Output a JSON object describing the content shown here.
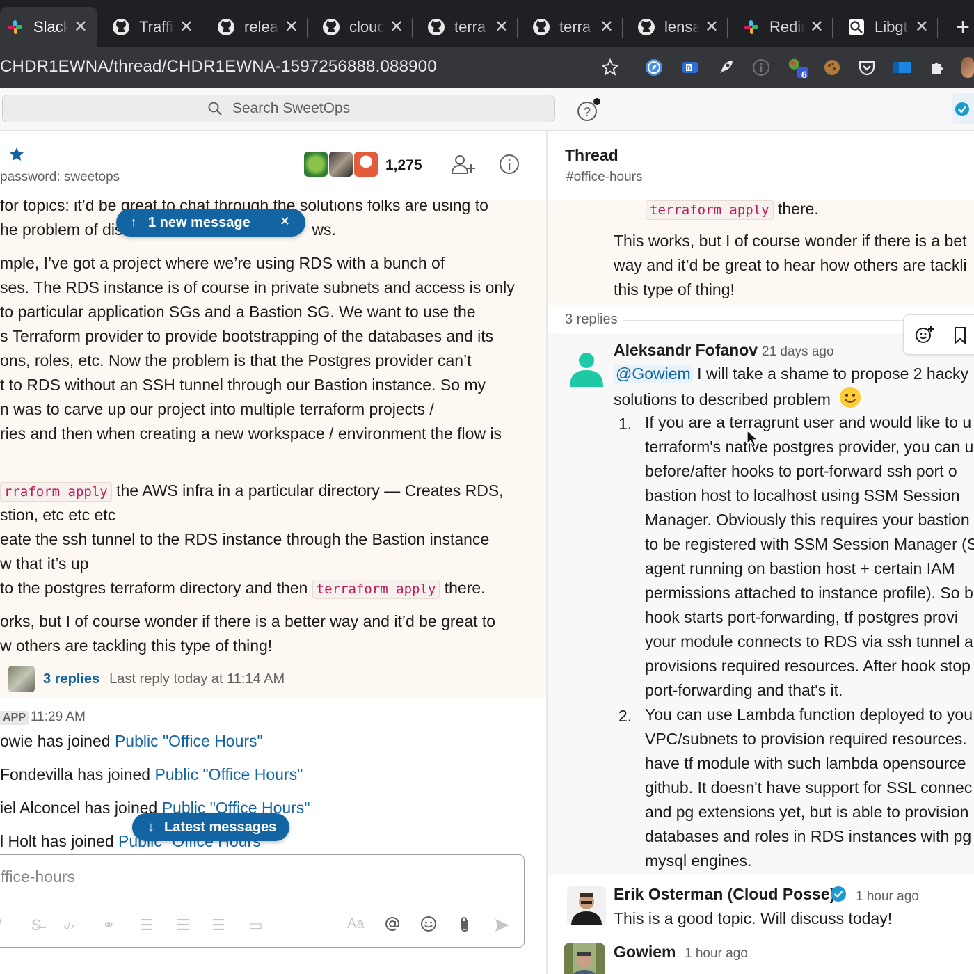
{
  "browser": {
    "tabs": [
      {
        "title": "Slack",
        "icon": "slack-icon",
        "active": true
      },
      {
        "title": "Traffi",
        "icon": "github-icon"
      },
      {
        "title": "relea",
        "icon": "github-icon"
      },
      {
        "title": "clouc",
        "icon": "github-icon"
      },
      {
        "title": "terra",
        "icon": "github-icon"
      },
      {
        "title": "terra",
        "icon": "github-icon"
      },
      {
        "title": "lensa",
        "icon": "github-icon"
      },
      {
        "title": "Redir",
        "icon": "slack-icon"
      },
      {
        "title": "Libgt",
        "icon": "search-icon"
      }
    ],
    "url": "CHDR1EWNA/thread/CHDR1EWNA-1597256888.088900",
    "extension_badge": "6"
  },
  "slack": {
    "search_placeholder": "Search SweetOps"
  },
  "channel": {
    "topic": "password: sweetops",
    "member_count": "1,275",
    "new_message_pill": "1 new message",
    "latest_messages_pill": "Latest messages",
    "composer_placeholder": "ffice-hours",
    "message_lines": [
      " for topics: it’d be great to chat through the solutions folks are using to",
      "he problem of dis",
      "ws.",
      "mple, I’ve got a project where we’re using RDS with a bunch of",
      "ses. The RDS instance is of course in private subnets and access is only",
      "to particular application SGs and a Bastion SG. We want to use the",
      "s Terraform provider to provide bootstrapping of the databases and its",
      "ons, roles, etc. Now the problem is that the Postgres provider can’t",
      "t to RDS without an SSH tunnel through our Bastion instance. So my",
      "n was to carve up our project into multiple terraform projects /",
      "ries and then when creating a new workspace / environment the flow is"
    ],
    "code_apply_1": "rraform apply",
    "step1_rest": " the AWS infra in a particular directory — Creates RDS,",
    "step1_cont": "stion, etc etc etc",
    "step2": "eate the ssh tunnel to the RDS instance through the Bastion instance",
    "step2_cont": "w that it’s up",
    "step3_pre": " to the postgres terraform directory and then ",
    "code_apply_2": "terraform apply",
    "step3_post": " there.",
    "closing_1": "orks, but I of course wonder if there is a better way and it’d be great to",
    "closing_2": "w others are tackling this type of thing!",
    "replies_link": "3 replies",
    "last_reply": "Last reply today at 11:14 AM",
    "app_tag": "APP",
    "app_time": "11:29 AM",
    "joins": [
      {
        "who": "owie has joined ",
        "where": "Public \"Office Hours\""
      },
      {
        "who": "Fondevilla has joined ",
        "where": "Public \"Office Hours\""
      },
      {
        "who": "iel Alconcel has joined ",
        "where": "Public \"Office Hours\""
      },
      {
        "who": "l Holt has joined ",
        "where": "Public \"Office Hours\""
      }
    ]
  },
  "thread": {
    "title": "Thread",
    "channel": "#office-hours",
    "parent_code": "terraform apply",
    "parent_after_code": " there.",
    "parent_lines": [
      "This works, but I of course wonder if there is a bet",
      "way and it’d be great to hear how others are tackli",
      "this type of thing!"
    ],
    "replies_count": "3 replies",
    "replies": [
      {
        "author": "Aleksandr Fofanov",
        "time": "21 days ago",
        "mention": "@Gowiem",
        "lead": " I will take a shame to propose 2 hacky",
        "lead2": "solutions to described problem",
        "item1_num": "1.",
        "item1": [
          "If you are a terragrunt user and would like to u",
          "terraform's native postgres provider, you can u",
          "before/after hooks to port-forward ssh port o",
          "bastion host to localhost using SSM Session",
          "Manager. Obviously this requires your bastion",
          "to be registered with SSM Session Manager (S",
          "agent running on bastion host + certain IAM",
          "permissions attached to instance profile). So b",
          "hook starts port-forwarding, tf postgres provi",
          "your module connects to RDS via ssh tunnel a",
          "provisions required resources. After hook stop",
          "port-forwarding and that's it."
        ],
        "item2_num": "2.",
        "item2": [
          "You can use Lambda function deployed to you",
          "VPC/subnets to provision required resources.",
          "have tf module with such lambda opensource",
          "github. It doesn't have support for SSL connec",
          "and pg extensions yet, but is able to provision",
          "databases and roles in RDS instances with pg",
          "mysql engines."
        ]
      },
      {
        "author": "Erik Osterman (Cloud Posse)",
        "time": "1 hour ago",
        "text": "This is a good topic. Will discuss today!"
      },
      {
        "author": "Gowiem",
        "time": "1 hour ago"
      }
    ]
  },
  "colors": {
    "link": "#1264a3",
    "highlight_bg": "#fdf8f1",
    "code_text": "#c2185b",
    "verified": "#1d9bd1"
  }
}
